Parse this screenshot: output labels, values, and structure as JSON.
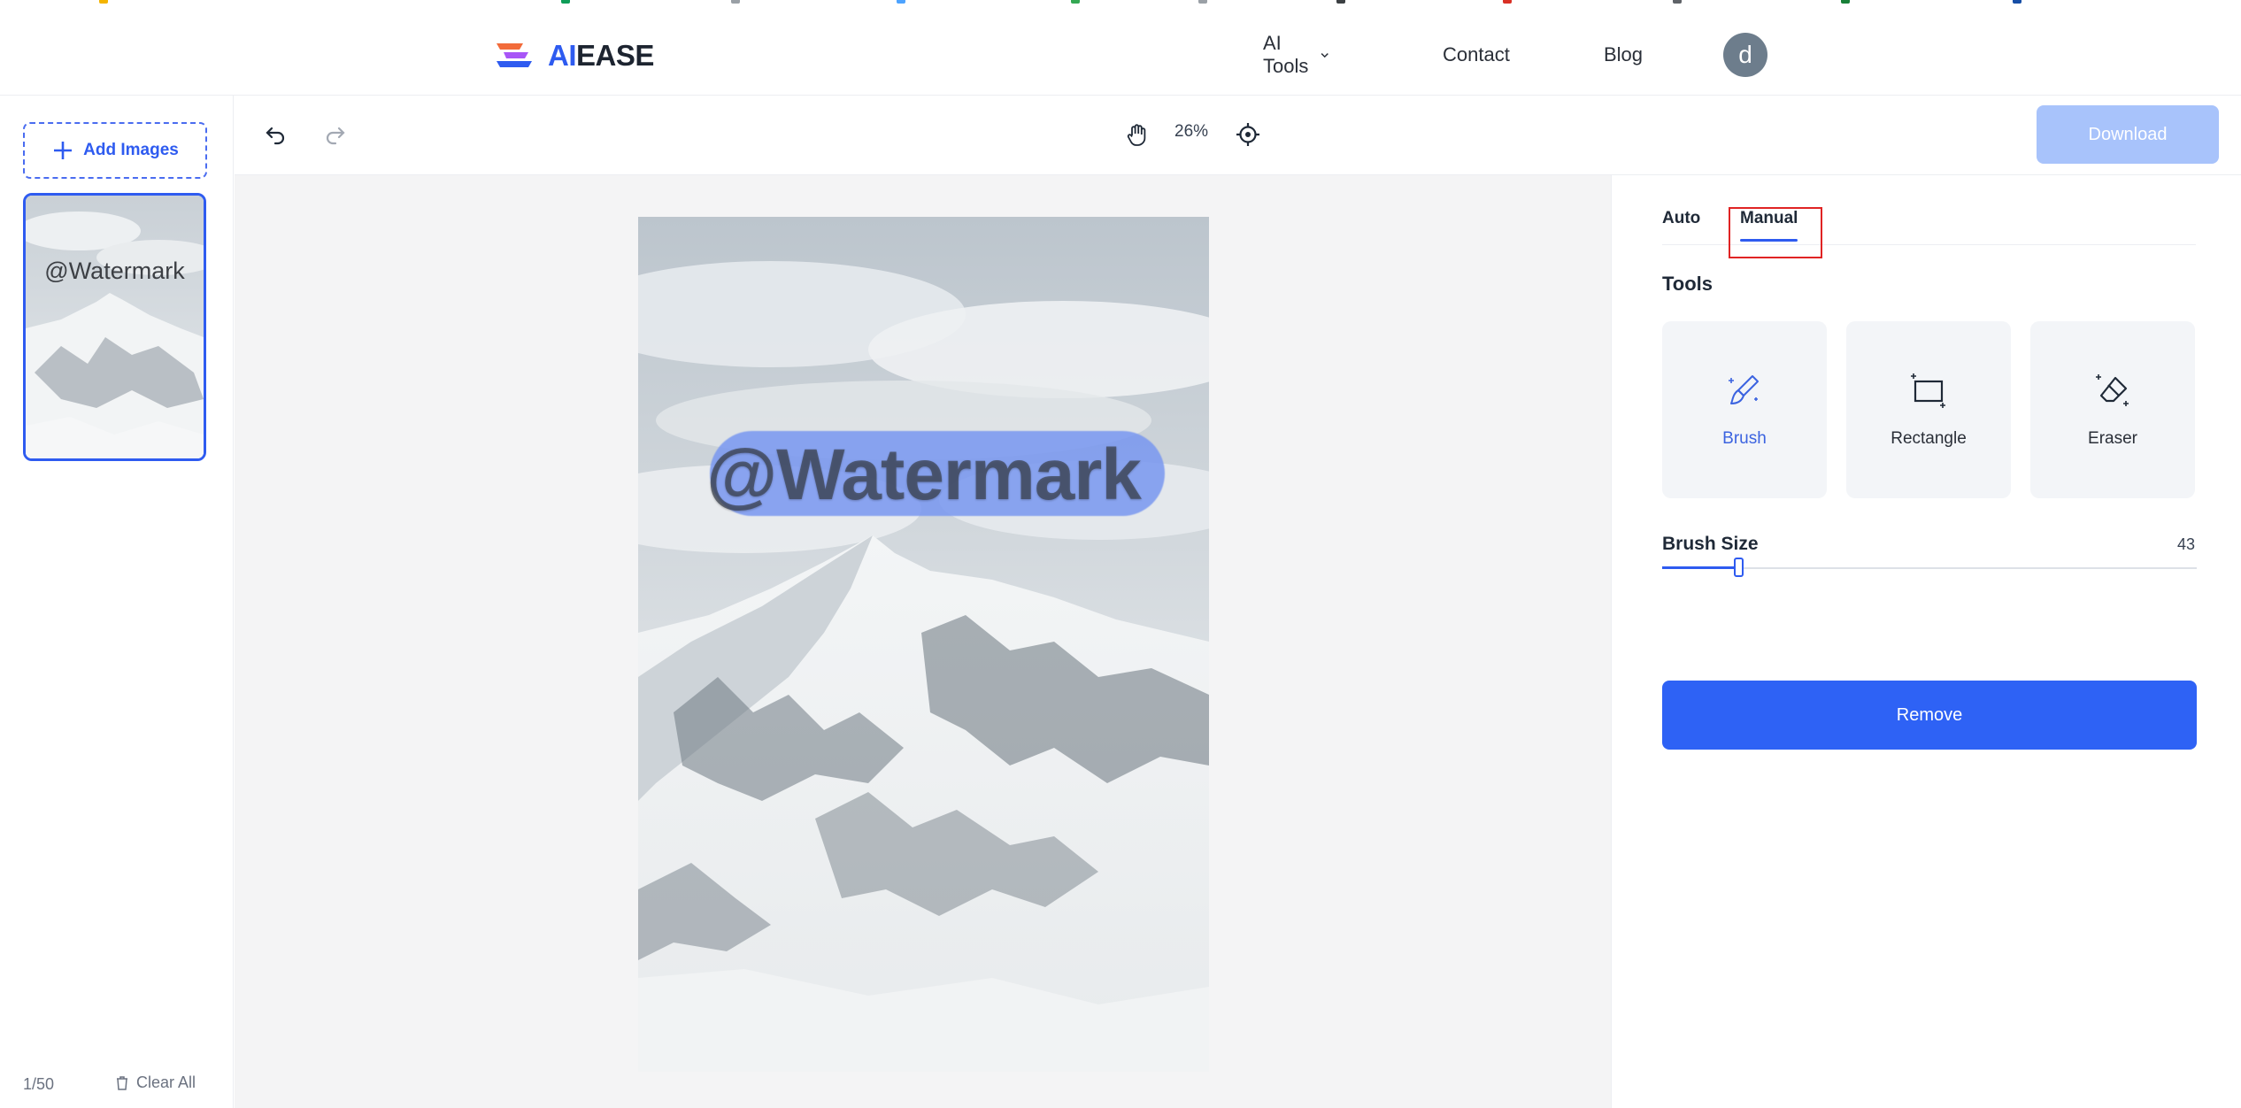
{
  "brand": {
    "logo_text_ai": "AI",
    "logo_text_ease": "EASE",
    "accent": "#2e5bf0"
  },
  "nav": {
    "items": [
      {
        "label": "AI Tools",
        "has_dropdown": true
      },
      {
        "label": "Contact"
      },
      {
        "label": "Blog"
      }
    ],
    "avatar_initial": "d"
  },
  "sidebar": {
    "add_images_label": "Add Images",
    "thumbnail_label": "@Watermark",
    "page_count": "1/50",
    "clear_all_label": "Clear All"
  },
  "toolbar": {
    "zoom": "26%",
    "download_label": "Download",
    "icons": [
      "undo-icon",
      "redo-icon",
      "hand-icon",
      "recenter-icon"
    ]
  },
  "canvas": {
    "watermark_text": "@Watermark"
  },
  "panel": {
    "tabs": [
      {
        "label": "Auto",
        "active": false
      },
      {
        "label": "Manual",
        "active": true
      }
    ],
    "tools_title": "Tools",
    "tools": [
      {
        "label": "Brush",
        "icon": "brush-icon",
        "active": true
      },
      {
        "label": "Rectangle",
        "icon": "rectangle-icon",
        "active": false
      },
      {
        "label": "Eraser",
        "icon": "eraser-icon",
        "active": false
      }
    ],
    "brush_size_title": "Brush Size",
    "brush_size_value": "43",
    "brush_size_fraction": 0.143,
    "remove_label": "Remove"
  }
}
